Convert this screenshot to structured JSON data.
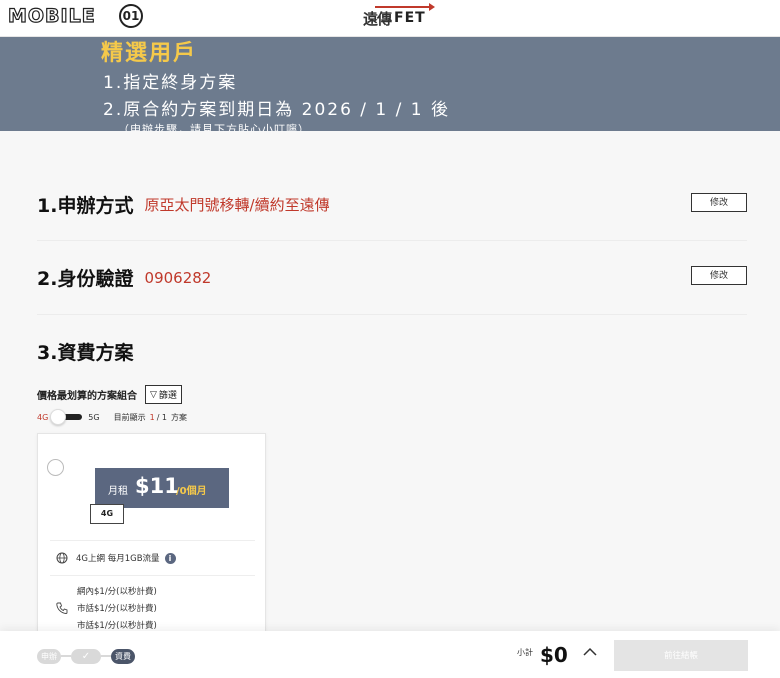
{
  "header": {
    "mobile_logo": "MOBILE",
    "mobile_logo_mark": "01",
    "brand_zh": "遠傳",
    "brand_en": "FET"
  },
  "banner": {
    "title": "精選用戶",
    "line1": "1.指定終身方案",
    "line2": "2.原合約方案到期日為 2026 / 1 / 1 後",
    "note": "（申辦步驟，請見下方貼心小叮嚀）"
  },
  "steps": {
    "s1_title": "1.申辦方式",
    "s1_value": "原亞太門號移轉/續約至遠傳",
    "s2_title": "2.身份驗證",
    "s2_value": "0906282",
    "s3_title": "3.資費方案",
    "edit_label": "修改"
  },
  "filter": {
    "label": "價格最划算的方案組合",
    "button": "篩選",
    "toggle_left": "4G",
    "toggle_right": "5G",
    "count_prefix": "目前顯示",
    "count_current": "1",
    "count_total": "/ 1",
    "count_suffix": "方案"
  },
  "plan": {
    "price_label": "月租",
    "price": "$11",
    "period": "/0個月",
    "network": "4G",
    "data_feature": "4G上網 每月1GB流量",
    "call_lines": [
      "網內$1/分(以秒計費)",
      "市話$1/分(以秒計費)",
      "市話$1/分(以秒計費)"
    ]
  },
  "footer": {
    "step_apply": "申辦",
    "step_check": "✓",
    "step_plan": "資費",
    "subtotal_label": "小計",
    "subtotal": "$0",
    "checkout": "前往結帳"
  },
  "colors": {
    "accent_red": "#c0392b",
    "banner_bg": "#6d7b8e",
    "banner_title": "#f5c94a",
    "price_box": "#5b6780"
  }
}
